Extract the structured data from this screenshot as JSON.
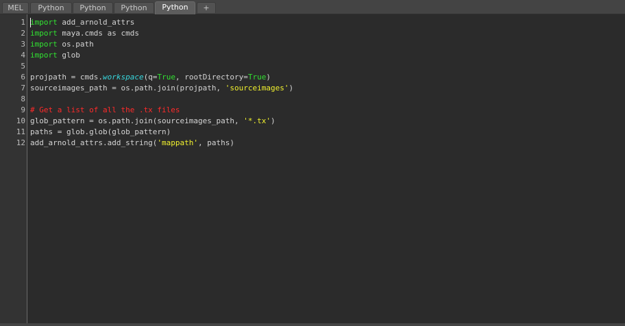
{
  "tabs": [
    {
      "label": "MEL",
      "active": false
    },
    {
      "label": "Python",
      "active": false
    },
    {
      "label": "Python",
      "active": false
    },
    {
      "label": "Python",
      "active": false
    },
    {
      "label": "Python",
      "active": true
    },
    {
      "label": "+",
      "active": false
    }
  ],
  "colors": {
    "keyword": "#31e131",
    "string": "#f1f12e",
    "comment": "#ff2a2a",
    "function": "#37d8de",
    "text": "#d4d4d4",
    "background": "#2b2b2b"
  },
  "editor": {
    "line_numbers": [
      "1",
      "2",
      "3",
      "4",
      "5",
      "6",
      "7",
      "8",
      "9",
      "10",
      "11",
      "12"
    ],
    "lines": [
      [
        {
          "t": "import",
          "c": "kw"
        },
        {
          "t": " add_arnold_attrs",
          "c": ""
        }
      ],
      [
        {
          "t": "import",
          "c": "kw"
        },
        {
          "t": " maya.cmds as cmds",
          "c": ""
        }
      ],
      [
        {
          "t": "import",
          "c": "kw"
        },
        {
          "t": " os.path",
          "c": ""
        }
      ],
      [
        {
          "t": "import",
          "c": "kw"
        },
        {
          "t": " glob",
          "c": ""
        }
      ],
      [],
      [
        {
          "t": "projpath = cmds.",
          "c": ""
        },
        {
          "t": "workspace",
          "c": "fn"
        },
        {
          "t": "(q=",
          "c": ""
        },
        {
          "t": "True",
          "c": "bool"
        },
        {
          "t": ", rootDirectory=",
          "c": ""
        },
        {
          "t": "True",
          "c": "bool"
        },
        {
          "t": ")",
          "c": ""
        }
      ],
      [
        {
          "t": "sourceimages_path = os.path.join(projpath, ",
          "c": ""
        },
        {
          "t": "'sourceimages'",
          "c": "str"
        },
        {
          "t": ")",
          "c": ""
        }
      ],
      [],
      [
        {
          "t": "# Get a list of all the .tx files",
          "c": "cmt"
        }
      ],
      [
        {
          "t": "glob_pattern = os.path.join(sourceimages_path, ",
          "c": ""
        },
        {
          "t": "'*.tx'",
          "c": "str"
        },
        {
          "t": ")",
          "c": ""
        }
      ],
      [
        {
          "t": "paths = glob.glob(glob_pattern)",
          "c": ""
        }
      ],
      [
        {
          "t": "add_arnold_attrs.add_string(",
          "c": ""
        },
        {
          "t": "'mappath'",
          "c": "str"
        },
        {
          "t": ", paths)",
          "c": ""
        }
      ]
    ]
  }
}
